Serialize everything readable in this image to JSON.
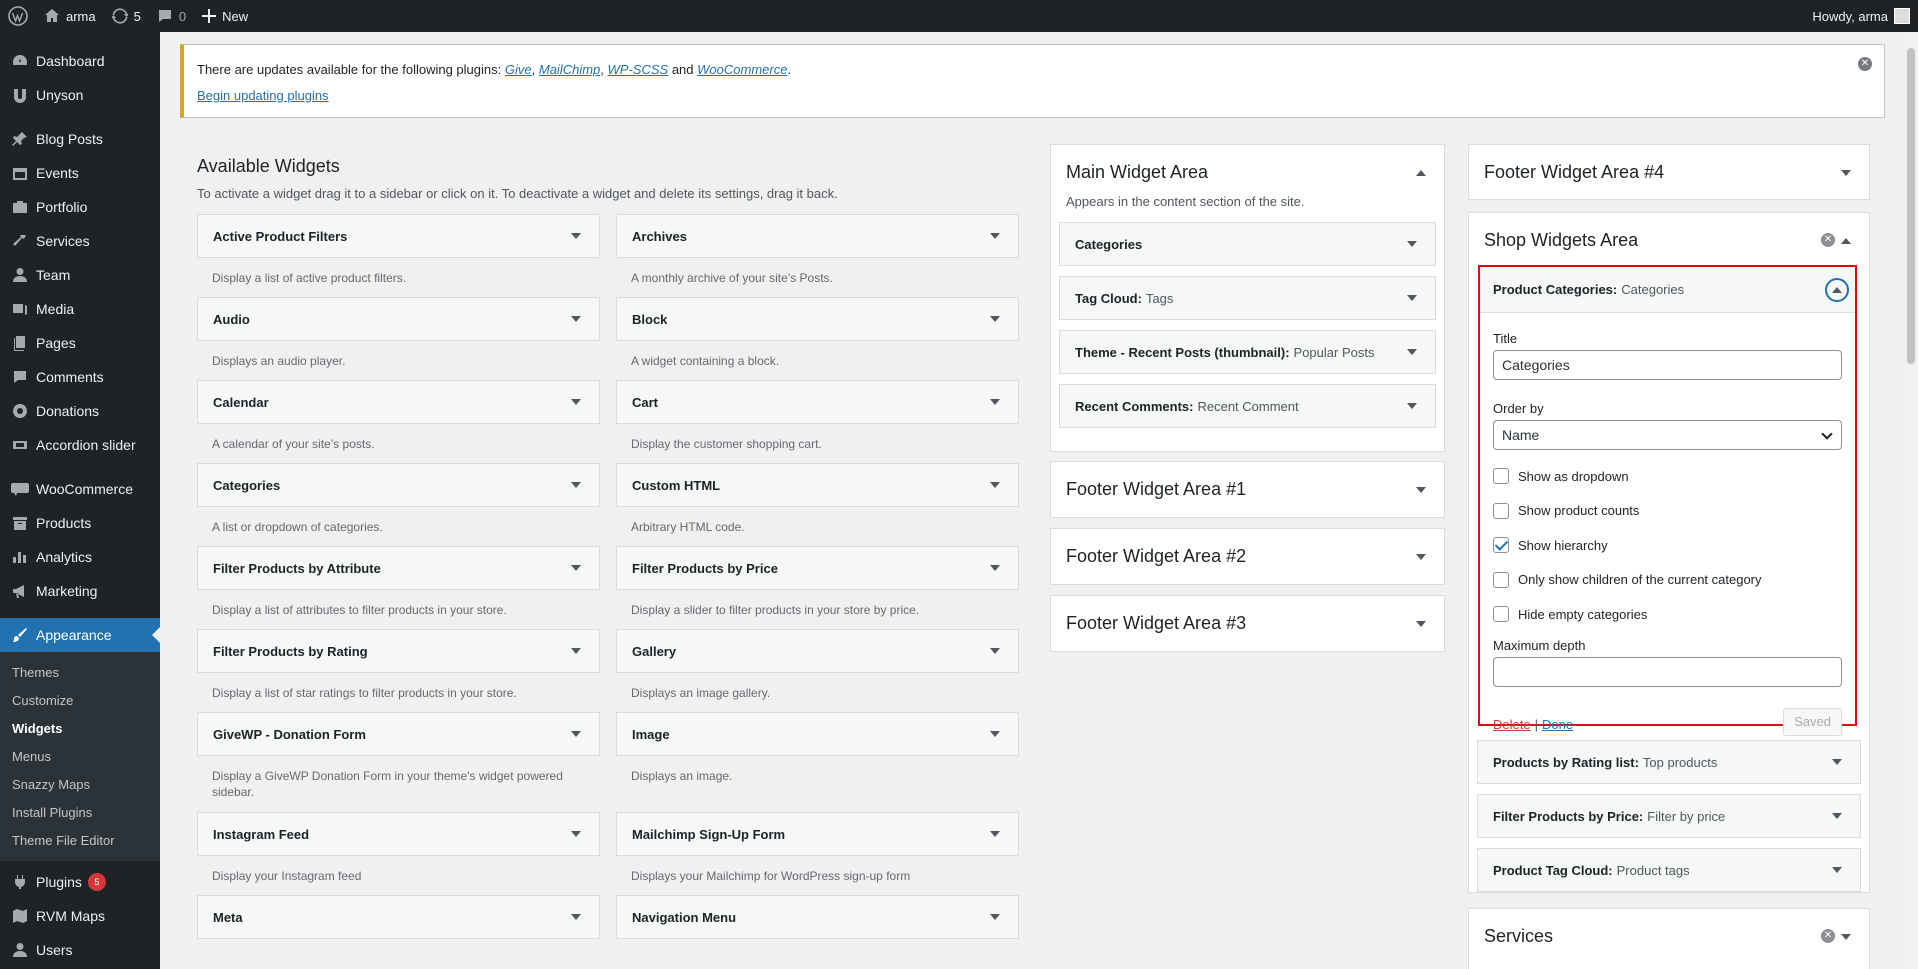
{
  "adminbar": {
    "site_name": "arma",
    "updates_count": "5",
    "comments_count": "0",
    "new_label": "New",
    "howdy": "Howdy, arma"
  },
  "menu": {
    "items_top": [
      {
        "label": "Dashboard",
        "icon": "dashboard-icon"
      },
      {
        "label": "Unyson",
        "icon": "unyson-icon"
      }
    ],
    "items_mid": [
      {
        "label": "Blog Posts",
        "icon": "pin-icon"
      },
      {
        "label": "Events",
        "icon": "calendar-icon"
      },
      {
        "label": "Portfolio",
        "icon": "portfolio-icon"
      },
      {
        "label": "Services",
        "icon": "hammer-icon"
      },
      {
        "label": "Team",
        "icon": "person-icon"
      },
      {
        "label": "Media",
        "icon": "media-icon"
      },
      {
        "label": "Pages",
        "icon": "pages-icon"
      },
      {
        "label": "Comments",
        "icon": "comment-icon"
      },
      {
        "label": "Donations",
        "icon": "give-icon"
      },
      {
        "label": "Accordion slider",
        "icon": "slider-icon"
      }
    ],
    "items_woo": [
      {
        "label": "WooCommerce",
        "icon": "woo-icon"
      },
      {
        "label": "Products",
        "icon": "archive-icon"
      },
      {
        "label": "Analytics",
        "icon": "chart-icon"
      },
      {
        "label": "Marketing",
        "icon": "megaphone-icon"
      }
    ],
    "appearance": "Appearance",
    "submenu": [
      "Themes",
      "Customize",
      "Widgets",
      "Menus",
      "Snazzy Maps",
      "Install Plugins",
      "Theme File Editor"
    ],
    "plugins": "Plugins",
    "plugins_badge": "5",
    "rvm_maps": "RVM Maps",
    "users": "Users"
  },
  "notice": {
    "text": "There are updates available for the following plugins:",
    "plugins": [
      "Give",
      "MailChimp",
      "WP-SCSS",
      "WooCommerce"
    ],
    "sep1": ",",
    "sep2": ",",
    "and": "and",
    "end": ".",
    "begin_link": "Begin updating plugins"
  },
  "available": {
    "title": "Available Widgets",
    "description": "To activate a widget drag it to a sidebar or click on it. To deactivate a widget and delete its settings, drag it back.",
    "widgets": [
      {
        "name": "Active Product Filters",
        "desc": "Display a list of active product filters."
      },
      {
        "name": "Archives",
        "desc": "A monthly archive of your site’s Posts."
      },
      {
        "name": "Audio",
        "desc": "Displays an audio player."
      },
      {
        "name": "Block",
        "desc": "A widget containing a block."
      },
      {
        "name": "Calendar",
        "desc": "A calendar of your site’s posts."
      },
      {
        "name": "Cart",
        "desc": "Display the customer shopping cart."
      },
      {
        "name": "Categories",
        "desc": "A list or dropdown of categories."
      },
      {
        "name": "Custom HTML",
        "desc": "Arbitrary HTML code."
      },
      {
        "name": "Filter Products by Attribute",
        "desc": "Display a list of attributes to filter products in your store."
      },
      {
        "name": "Filter Products by Price",
        "desc": "Display a slider to filter products in your store by price."
      },
      {
        "name": "Filter Products by Rating",
        "desc": "Display a list of star ratings to filter products in your store."
      },
      {
        "name": "Gallery",
        "desc": "Displays an image gallery."
      },
      {
        "name": "GiveWP - Donation Form",
        "desc": "Display a GiveWP Donation Form in your theme's widget powered sidebar."
      },
      {
        "name": "Image",
        "desc": "Displays an image."
      },
      {
        "name": "Instagram Feed",
        "desc": "Display your Instagram feed"
      },
      {
        "name": "Mailchimp Sign-Up Form",
        "desc": "Displays your Mailchimp for WordPress sign-up form"
      },
      {
        "name": "Meta",
        "desc": ""
      },
      {
        "name": "Navigation Menu",
        "desc": ""
      }
    ]
  },
  "main_area": {
    "title": "Main Widget Area",
    "description": "Appears in the content section of the site.",
    "widgets": [
      {
        "name": "Categories",
        "title": ""
      },
      {
        "name": "Tag Cloud:",
        "title": "Tags"
      },
      {
        "name": "Theme - Recent Posts (thumbnail):",
        "title": "Popular Posts"
      },
      {
        "name": "Recent Comments:",
        "title": "Recent Comment"
      }
    ]
  },
  "footer_areas": [
    "Footer Widget Area #1",
    "Footer Widget Area #2",
    "Footer Widget Area #3"
  ],
  "footer4": "Footer Widget Area #4",
  "shop_area": {
    "title": "Shop Widgets Area",
    "editor": {
      "name": "Product Categories:",
      "title_suffix": "Categories",
      "title_label": "Title",
      "title_value": "Categories",
      "orderby_label": "Order by",
      "orderby_value": "Name",
      "options": [
        {
          "label": "Show as dropdown",
          "checked": false
        },
        {
          "label": "Show product counts",
          "checked": false
        },
        {
          "label": "Show hierarchy",
          "checked": true
        },
        {
          "label": "Only show children of the current category",
          "checked": false
        },
        {
          "label": "Hide empty categories",
          "checked": false
        }
      ],
      "depth_label": "Maximum depth",
      "depth_value": "",
      "delete": "Delete",
      "sep": "|",
      "done": "Done",
      "saved": "Saved"
    },
    "widgets": [
      {
        "name": "Products by Rating list:",
        "title": "Top products"
      },
      {
        "name": "Filter Products by Price:",
        "title": "Filter by price"
      },
      {
        "name": "Product Tag Cloud:",
        "title": "Product tags"
      }
    ]
  },
  "services_area": "Services",
  "colors": {
    "accent": "#2271b1",
    "highlight": "#e00a12",
    "warning": "#dba617",
    "sidebar": "#1d2327"
  }
}
